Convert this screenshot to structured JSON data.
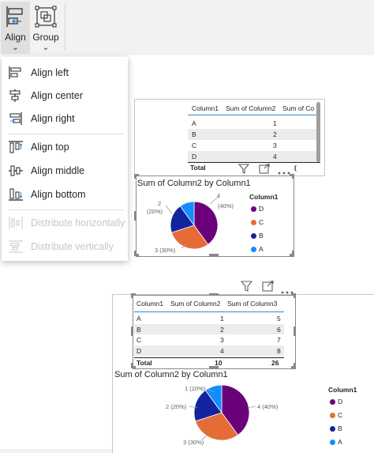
{
  "ribbon": {
    "align_label": "Align",
    "group_label": "Group"
  },
  "menu": {
    "items": [
      {
        "label": "Align left",
        "icon": "align-left-icon",
        "enabled": true
      },
      {
        "label": "Align center",
        "icon": "align-center-icon",
        "enabled": true
      },
      {
        "label": "Align right",
        "icon": "align-right-icon",
        "enabled": true
      },
      {
        "label": "Align top",
        "icon": "align-top-icon",
        "enabled": true
      },
      {
        "label": "Align middle",
        "icon": "align-middle-icon",
        "enabled": true
      },
      {
        "label": "Align bottom",
        "icon": "align-bottom-icon",
        "enabled": true
      },
      {
        "label": "Distribute horizontally",
        "icon": "distribute-horizontally-icon",
        "enabled": false
      },
      {
        "label": "Distribute vertically",
        "icon": "distribute-vertically-icon",
        "enabled": false
      }
    ]
  },
  "colors": {
    "A": "#118dff",
    "B": "#12239e",
    "C": "#e66c37",
    "D": "#6b007b",
    "accent": "#2b88d8"
  },
  "top_visual": {
    "table": {
      "headers": [
        "Column1",
        "Sum of Column2",
        "Sum of Co"
      ],
      "rows": [
        [
          "A",
          "1"
        ],
        [
          "B",
          "2"
        ],
        [
          "C",
          "3"
        ],
        [
          "D",
          "4"
        ]
      ],
      "total": [
        "Total",
        "",
        "("
      ]
    },
    "pie": {
      "title": "Sum of Column2 by Column1",
      "labels": [
        "4\n(40%)",
        "2\n(20%)",
        "3 (30%)"
      ],
      "legend_title": "Column1",
      "legend": [
        "D",
        "C",
        "B",
        "A"
      ]
    }
  },
  "bottom_visual": {
    "table": {
      "headers": [
        "Column1",
        "Sum of Column2",
        "Sum of Column3"
      ],
      "rows": [
        [
          "A",
          "1",
          "5"
        ],
        [
          "B",
          "2",
          "6"
        ],
        [
          "C",
          "3",
          "7"
        ],
        [
          "D",
          "4",
          "8"
        ]
      ],
      "total": [
        "Total",
        "10",
        "26"
      ]
    },
    "pie": {
      "title": "Sum of Column2 by Column1",
      "labels": [
        "1 (10%)",
        "2 (20%)",
        "3 (30%)",
        "4 (40%)"
      ],
      "legend_title": "Column1",
      "legend": [
        "D",
        "C",
        "B",
        "A"
      ]
    }
  },
  "chart_data": [
    {
      "type": "table",
      "columns": [
        "Column1",
        "Sum of Column2",
        "Sum of Co"
      ],
      "rows": [
        [
          "A",
          1
        ],
        [
          "B",
          2
        ],
        [
          "C",
          3
        ],
        [
          "D",
          4
        ]
      ],
      "total_row_label": "Total"
    },
    {
      "type": "pie",
      "title": "Sum of Column2 by Column1",
      "categories": [
        "D",
        "C",
        "B",
        "A"
      ],
      "values": [
        4,
        3,
        2,
        1
      ],
      "percentages": [
        40,
        30,
        20,
        10
      ],
      "legend_title": "Column1",
      "legend_position": "right"
    },
    {
      "type": "table",
      "columns": [
        "Column1",
        "Sum of Column2",
        "Sum of Column3"
      ],
      "rows": [
        [
          "A",
          1,
          5
        ],
        [
          "B",
          2,
          6
        ],
        [
          "C",
          3,
          7
        ],
        [
          "D",
          4,
          8
        ]
      ],
      "total": [
        "Total",
        10,
        26
      ]
    },
    {
      "type": "pie",
      "title": "Sum of Column2 by Column1",
      "categories": [
        "D",
        "C",
        "B",
        "A"
      ],
      "values": [
        4,
        3,
        2,
        1
      ],
      "percentages": [
        40,
        30,
        20,
        10
      ],
      "legend_title": "Column1",
      "legend_position": "right"
    }
  ]
}
